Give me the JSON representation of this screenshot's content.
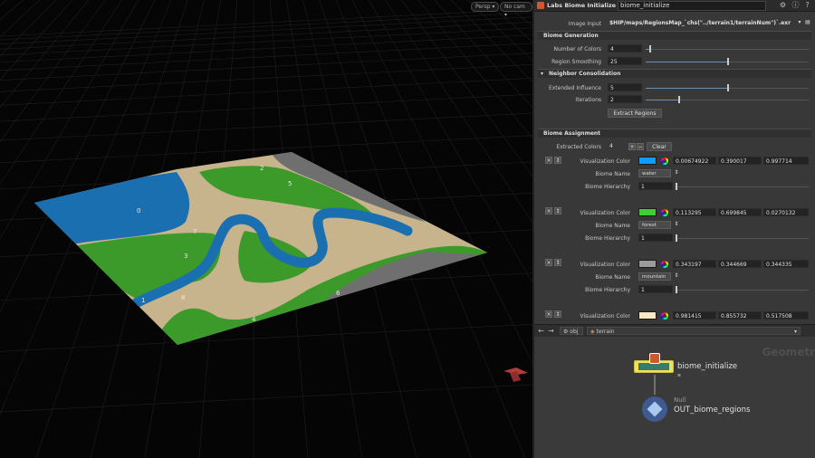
{
  "viewport": {
    "perspective_label": "Persp",
    "camera_label": "No cam",
    "region_ids": [
      "0",
      "1",
      "2",
      "3",
      "4",
      "5",
      "6",
      "7",
      "8"
    ],
    "colors": {
      "water": "#1a6fb0",
      "forest": "#3b9a2a",
      "sand": "#c7b48d",
      "mountain": "#6f6f6f"
    }
  },
  "header": {
    "node_type": "Labs Biome Initialize (Beta)",
    "node_name": "biome_initialize"
  },
  "params": {
    "image_input": {
      "label": "Image Input",
      "value": "$HIP/maps/RegionsMap_`chs(\"../terrain1/terrainNum\")`.exr"
    },
    "biome_generation": {
      "title": "Biome Generation",
      "number_of_colors": {
        "label": "Number of Colors",
        "value": "4",
        "fraction": 0.02
      },
      "region_smoothing": {
        "label": "Region Smoothing",
        "value": "25",
        "fraction": 0.5
      }
    },
    "neighbor": {
      "title": "Neighbor Consolidation",
      "extended_influence": {
        "label": "Extended Influence",
        "value": "5",
        "fraction": 0.5
      },
      "iterations": {
        "label": "Iterations",
        "value": "2",
        "fraction": 0.2
      },
      "extract_button": "Extract Regions"
    },
    "biome_assignment": {
      "title": "Biome Assignment",
      "extracted_colors": {
        "label": "Extracted Colors",
        "value": "4"
      },
      "add": "+",
      "remove": "−",
      "clear_button": "Clear",
      "color_label": "Visualization Color",
      "name_label": "Biome Name",
      "hier_label": "Biome Hierarchy",
      "biomes": [
        {
          "swatch": "#119bff",
          "r": "0.00674922",
          "g": "0.390017",
          "b": "0.997714",
          "name": "water",
          "hier": "1"
        },
        {
          "swatch": "#3cd035",
          "r": "0.113295",
          "g": "0.699845",
          "b": "0.0270132",
          "name": "forest",
          "hier": "1"
        },
        {
          "swatch": "#9c9c9c",
          "r": "0.343197",
          "g": "0.344669",
          "b": "0.344335",
          "name": "mountain",
          "hier": "1"
        },
        {
          "swatch": "#fbe9c4",
          "r": "0.981415",
          "g": "0.855732",
          "b": "0.517508"
        }
      ]
    }
  },
  "network": {
    "path_obj": "obj",
    "path_node": "terrain",
    "context_label": "Geometr",
    "node1_name": "biome_initialize",
    "node2_type": "Null",
    "node2_name": "OUT_biome_regions"
  }
}
